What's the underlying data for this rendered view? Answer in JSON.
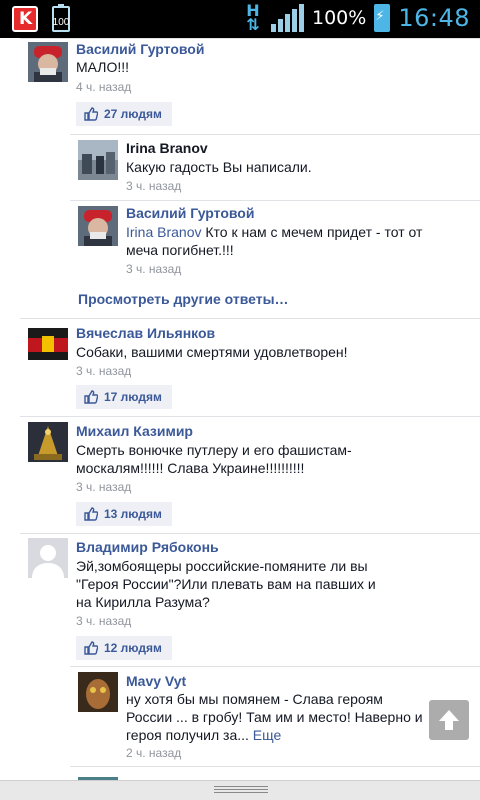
{
  "status_bar": {
    "battery_percent": "100%",
    "clock": "16:48",
    "small_battery_label": "100",
    "network_letter": "H"
  },
  "comments": [
    {
      "author": "Василий Гуртовой",
      "text": "МАЛО!!!",
      "time": "4 ч. назад",
      "likes": "27 людям",
      "replies": [
        {
          "author": "Irina Branov",
          "text": "Какую гадость Вы написали.",
          "time": "3 ч. назад"
        },
        {
          "author": "Василий Гуртовой",
          "mention": "Irina Branov",
          "text": " Кто к нам с мечем придет - тот от меча погибнет.!!!",
          "time": "3 ч. назад"
        }
      ],
      "more_replies": "Просмотреть другие ответы…"
    },
    {
      "author": "Вячеслав Ильянков",
      "text": "Собаки, вашими смертями удовлетворен!",
      "time": "3 ч. назад",
      "likes": "17 людям"
    },
    {
      "author": "Михаил Казимир",
      "text": "Смерть вонючке путлеру и его фашистам-москалям!!!!!! Слава Украине!!!!!!!!!!",
      "time": "3 ч. назад",
      "likes": "13 людям"
    },
    {
      "author": "Владимир Рябоконь",
      "text": "Эй,зомбоящеры российские-помяните ли вы \"Героя России\"?Или плевать вам на павших и на Кирилла Разума?",
      "time": "3 ч. назад",
      "likes": "12 людям",
      "replies": [
        {
          "author": "Mavy Vyt",
          "text": "ну хотя бы мы помянем - Слава героям России ... в гробу! Там им и место! Наверно и героя получил за...",
          "more": "Еще",
          "time": "2 ч. назад"
        }
      ]
    }
  ],
  "colors": {
    "link_blue": "#3b5998",
    "status_accent": "#4db6e6",
    "like_bg": "#eef0f5"
  }
}
